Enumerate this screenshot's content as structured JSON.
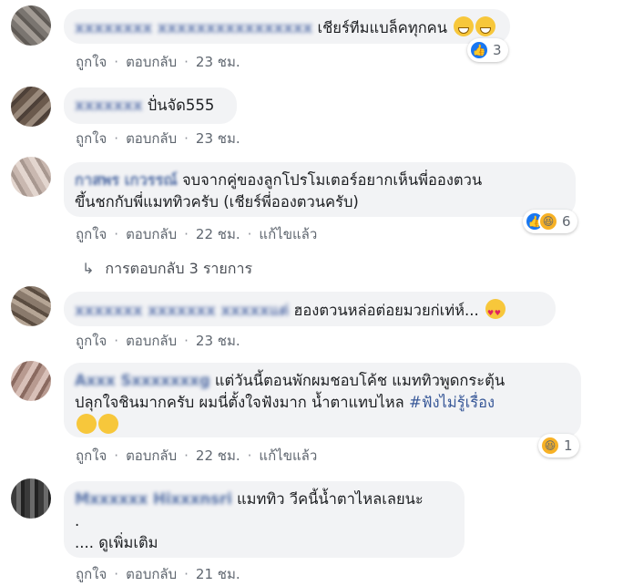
{
  "comments": [
    {
      "author": "xxxxxxxx xxxxxxxxxxxxxxxx",
      "text": "เชียร์ทีมแบล็คทุกคน",
      "emoji": "grinning-emoji",
      "actions": {
        "like": "ถูกใจ",
        "reply": "ตอบกลับ",
        "time": "23 ชม.",
        "edited": ""
      },
      "reactions": {
        "count": "3"
      }
    },
    {
      "author": "xxxxxxx",
      "text": "ปั่นจัด555",
      "actions": {
        "like": "ถูกใจ",
        "reply": "ตอบกลับ",
        "time": "23 ชม.",
        "edited": ""
      }
    },
    {
      "author": "กาสพร เกวรรณ์",
      "text_line1": "จบจากคู่ของลูกโปรโมเตอร์อยากเห็นพี่อองตวน",
      "text_line2": "ขึ้นชกกับพี่แมททิวครับ (เชียร์พี่อองตวนครับ)",
      "actions": {
        "like": "ถูกใจ",
        "reply": "ตอบกลับ",
        "time": "22 ชม.",
        "edited": "แก้ไขแล้ว"
      },
      "reactions": {
        "count": "6"
      },
      "replies": "การตอบกลับ 3 รายการ"
    },
    {
      "author": "xxxxxxx xxxxxxx xxxxxแต่",
      "text": "ฮองตวนหล่อต่อยมวยก่เท่ห์...",
      "actions": {
        "like": "ถูกใจ",
        "reply": "ตอบกลับ",
        "time": "23 ชม.",
        "edited": ""
      }
    },
    {
      "author": "Axxx Sxxxxxxxg",
      "text_line1": "แต่วันนี้ตอนพักผมชอบโค้ช แมททิวพูดกระตุ้น",
      "text_line2": "ปลุกใจชินมากครับ ผมนี่ตั้งใจฟังมาก น้ำตาแทบไหล",
      "hashtag": "#ฟังไม่รู้เรื่อง",
      "actions": {
        "like": "ถูกใจ",
        "reply": "ตอบกลับ",
        "time": "22 ชม.",
        "edited": "แก้ไขแล้ว"
      },
      "reactions": {
        "count": "1"
      }
    },
    {
      "author": "Mxxxxxx Hixxxnsri",
      "text": "แมททิว วีคนี้น้ำตาไหลเลยนะ",
      "text_line2": ".",
      "see_more": ".... ดูเพิ่มเติม",
      "actions": {
        "like": "ถูกใจ",
        "reply": "ตอบกลับ",
        "time": "21 ชม.",
        "edited": ""
      }
    }
  ],
  "colors": {
    "bubble": "#f2f3f5",
    "link": "#385898",
    "meta": "#606770",
    "like": "#1877f2",
    "haha": "#f7b125"
  }
}
